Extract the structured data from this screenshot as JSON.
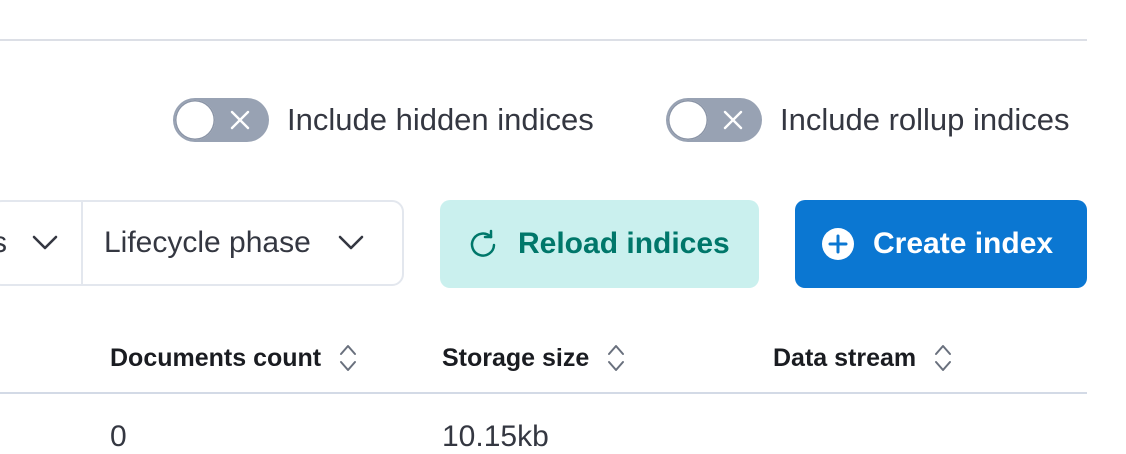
{
  "toggles": {
    "hidden_label": "Include hidden indices",
    "rollup_label": "Include rollup indices"
  },
  "filters": {
    "first_partial_label": "s",
    "lifecycle_label": "Lifecycle phase"
  },
  "buttons": {
    "reload_label": "Reload indices",
    "create_label": "Create index"
  },
  "table": {
    "columns": [
      "Documents count",
      "Storage size",
      "Data stream"
    ],
    "first_row": {
      "documents_count": "0",
      "storage_size": "10.15kb"
    }
  },
  "colors": {
    "reload_bg": "#caf0ee",
    "reload_text": "#00776a",
    "create_bg": "#0b77d2",
    "toggle_off": "#98a2b3"
  }
}
